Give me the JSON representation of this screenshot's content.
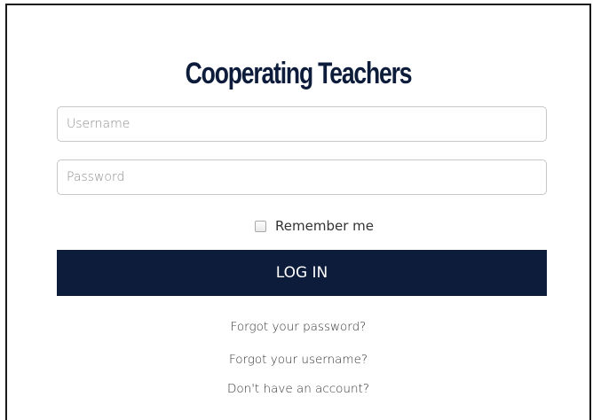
{
  "login_form": {
    "title": "Cooperating Teachers",
    "username": {
      "placeholder": "Username",
      "value": ""
    },
    "password": {
      "placeholder": "Password",
      "value": ""
    },
    "remember_label": "Remember me",
    "remember_checked": false,
    "login_label": "LOG IN"
  },
  "links": {
    "forgot_password": "Forgot your password?",
    "forgot_username": "Forgot your username?",
    "no_account": "Don't have an account?"
  },
  "colors": {
    "brand_navy": "#0e1c3b",
    "button_text": "#ffffff",
    "border": "#c8c8c8"
  }
}
